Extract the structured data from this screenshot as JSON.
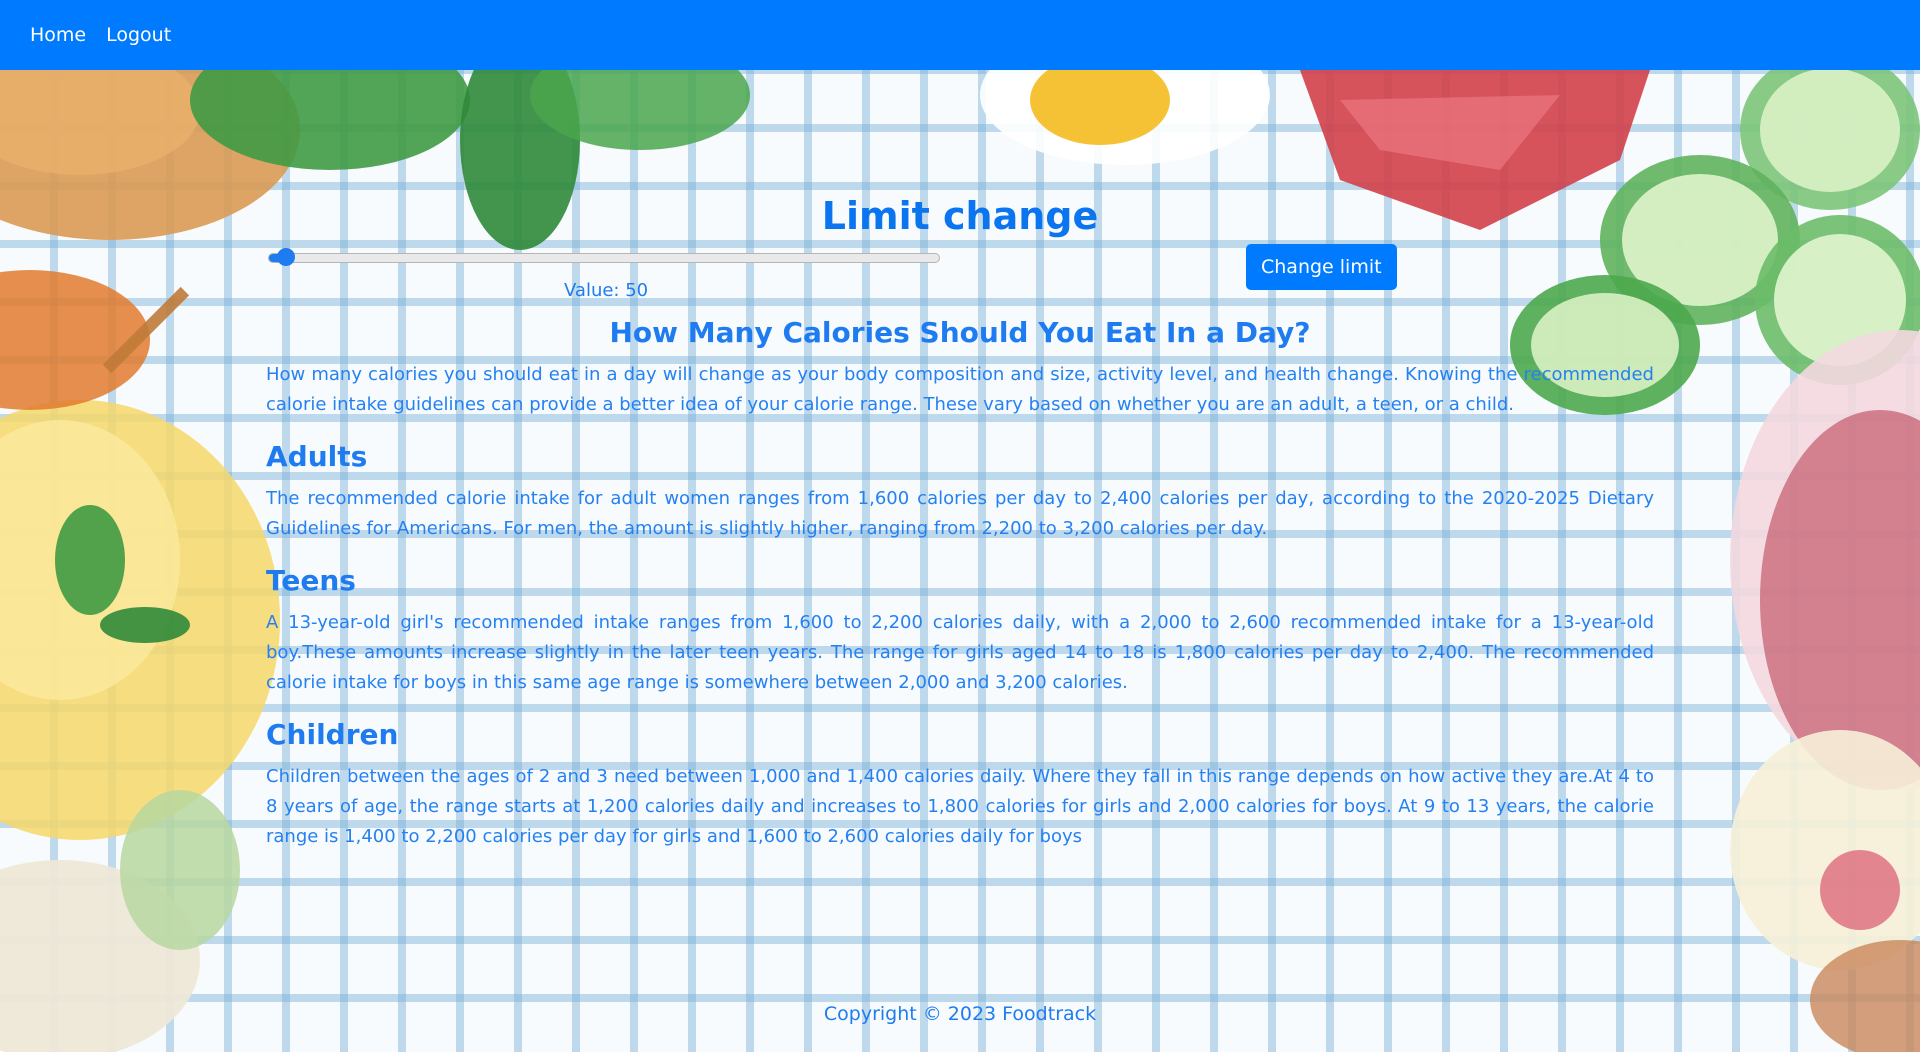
{
  "nav": {
    "home": "Home",
    "logout": "Logout"
  },
  "limit": {
    "title": "Limit change",
    "slider_value_label": "Value: 50",
    "slider_fraction": 0.02,
    "button_label": "Change limit"
  },
  "article": {
    "title": "How Many Calories Should You Eat In a Day?",
    "intro": "How many calories you should eat in a day will change as your body composition and size, activity level, and health change. Knowing the recommended calorie intake guidelines can provide a better idea of your calorie range. These vary based on whether you are an adult, a teen, or a child.",
    "sections": [
      {
        "heading": "Adults",
        "text": "The recommended calorie intake for adult women ranges from 1,600 calories per day to 2,400 calories per day, according to the 2020-2025 Dietary Guidelines for Americans. For men, the amount is slightly higher, ranging from 2,200 to 3,200 calories per day."
      },
      {
        "heading": "Teens",
        "text": "A 13-year-old girl's recommended intake ranges from 1,600 to 2,200 calories daily, with a 2,000 to 2,600 recommended intake for a 13-year-old boy.These amounts increase slightly in the later teen years. The range for girls aged 14 to 18 is 1,800 calories per day to 2,400. The recommended calorie intake for boys in this same age range is somewhere between 2,000 and 3,200 calories."
      },
      {
        "heading": "Children",
        "text": "Children between the ages of 2 and 3 need between 1,000 and 1,400 calories daily. Where they fall in this range depends on how active they are.At 4 to 8 years of age, the range starts at 1,200 calories daily and increases to 1,800 calories for girls and 2,000 calories for boys. At 9 to 13 years, the calorie range is 1,400 to 2,200 calories per day for girls and 1,600 to 2,600 calories daily for boys"
      }
    ]
  },
  "footer": {
    "copyright": "Copyright © 2023 Foodtrack"
  },
  "colors": {
    "primary": "#007bff",
    "text_blue": "#1e7cf0"
  }
}
